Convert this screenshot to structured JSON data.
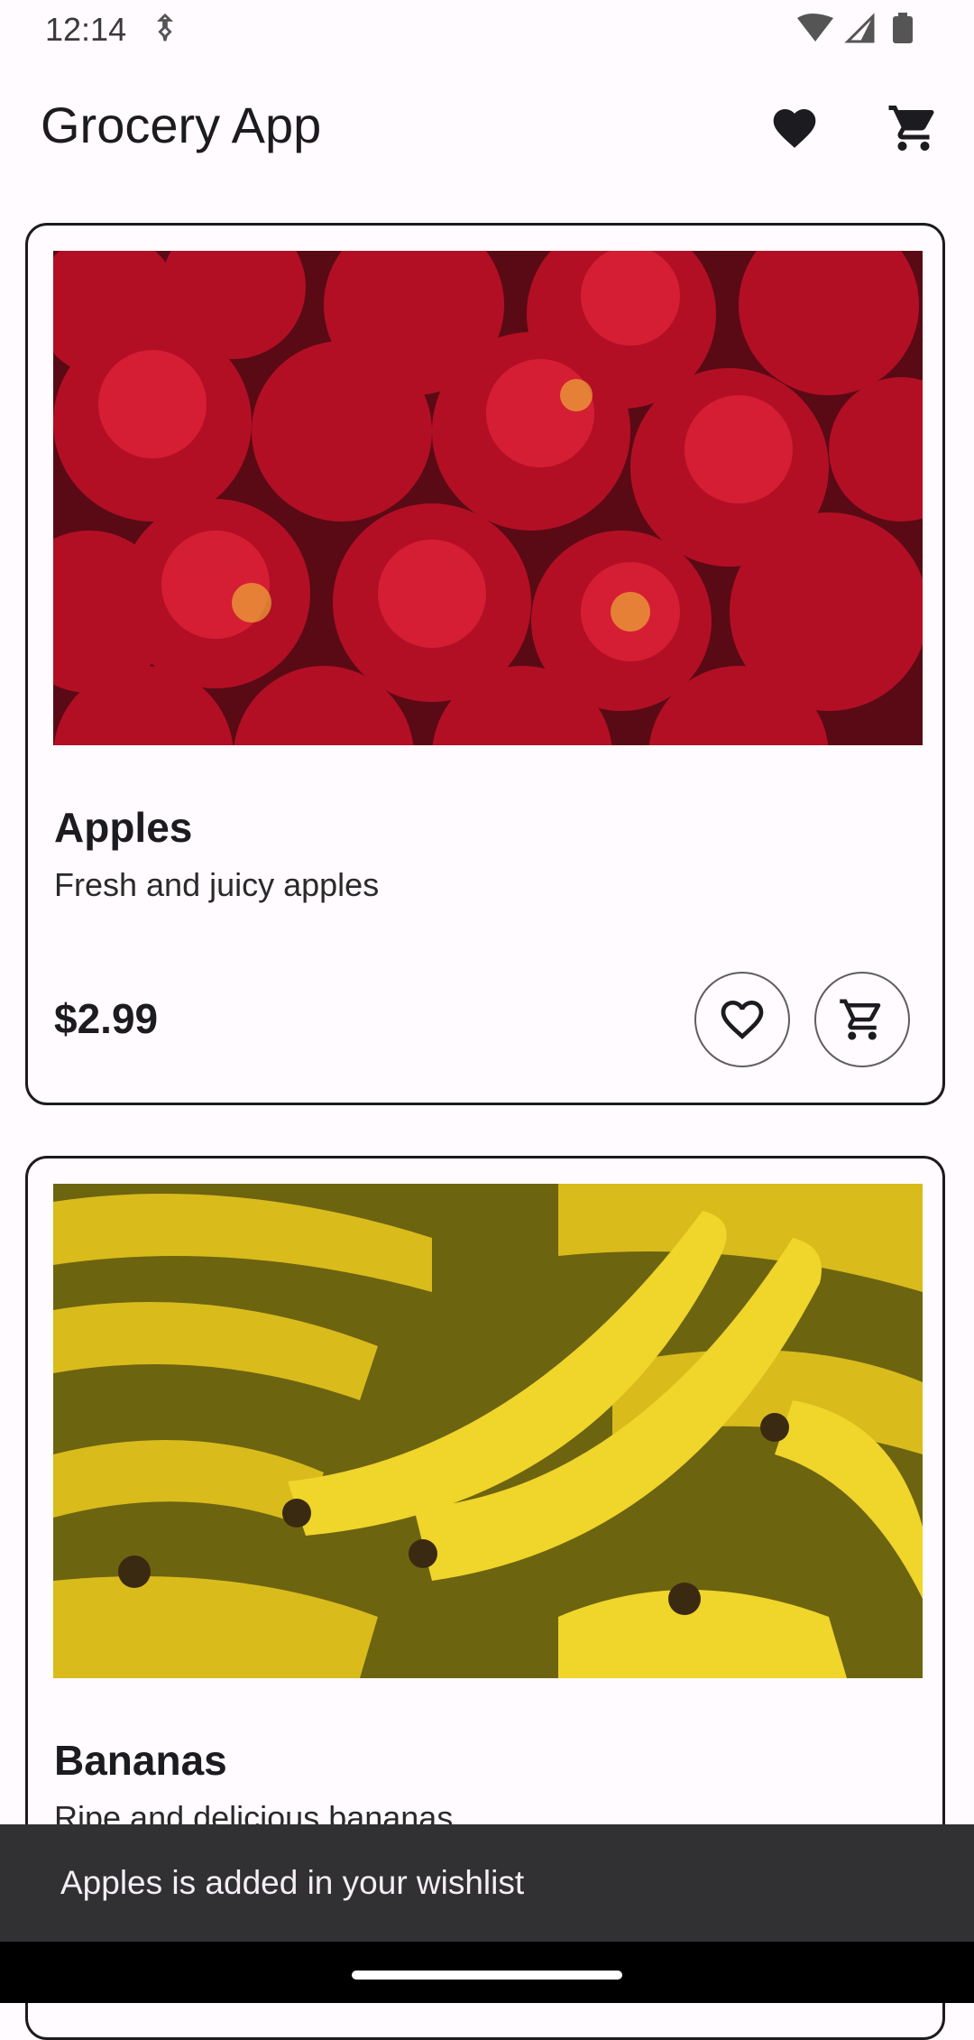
{
  "status_bar": {
    "time": "12:14"
  },
  "app_bar": {
    "title": "Grocery App",
    "wishlist_icon": "heart-filled-icon",
    "cart_icon": "shopping-cart-icon"
  },
  "products": [
    {
      "name": "Apples",
      "description": "Fresh and juicy apples",
      "price": "$2.99",
      "image": "apples-photo"
    },
    {
      "name": "Bananas",
      "description": "Ripe and delicious bananas",
      "price": "",
      "image": "bananas-photo"
    }
  ],
  "snackbar": {
    "message": "Apples is added in your wishlist"
  },
  "colors": {
    "background": "#fffbfe",
    "text": "#1c1b1f",
    "snackbar": "#313033",
    "apple_red": "#c0102a",
    "banana_yellow": "#e2c51e"
  }
}
